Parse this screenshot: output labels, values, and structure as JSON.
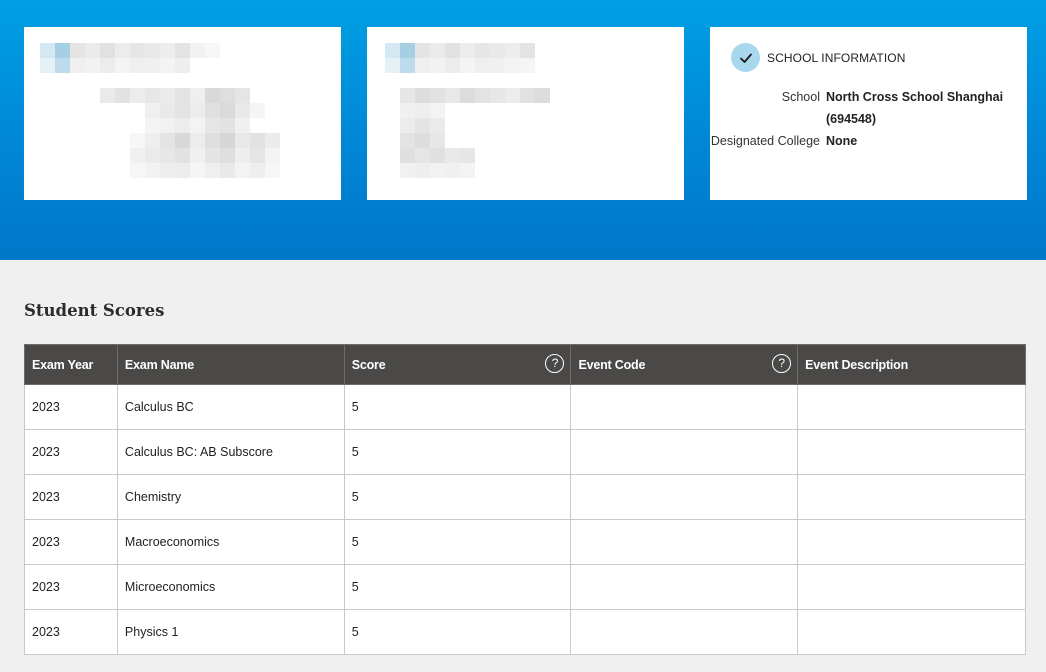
{
  "school_info": {
    "title": "SCHOOL INFORMATION",
    "school_label": "School",
    "school_value": "North Cross School Shanghai (694548)",
    "college_label": "Designated College",
    "college_value": "None"
  },
  "scores": {
    "heading": "Student Scores",
    "columns": [
      "Exam Year",
      "Exam Name",
      "Score",
      "Event Code",
      "Event Description"
    ],
    "help_glyph": "?",
    "rows": [
      {
        "year": "2023",
        "name": "Calculus BC",
        "score": "5",
        "event_code": "",
        "event_description": ""
      },
      {
        "year": "2023",
        "name": "Calculus BC: AB Subscore",
        "score": "5",
        "event_code": "",
        "event_description": ""
      },
      {
        "year": "2023",
        "name": "Chemistry",
        "score": "5",
        "event_code": "",
        "event_description": ""
      },
      {
        "year": "2023",
        "name": "Macroeconomics",
        "score": "5",
        "event_code": "",
        "event_description": ""
      },
      {
        "year": "2023",
        "name": "Microeconomics",
        "score": "5",
        "event_code": "",
        "event_description": ""
      },
      {
        "year": "2023",
        "name": "Physics 1",
        "score": "5",
        "event_code": "",
        "event_description": ""
      }
    ]
  },
  "colors": {
    "hero_top": "#009fe3",
    "hero_bottom": "#0077c8",
    "table_header": "#4a4948",
    "check_badge": "#a9d8ee"
  }
}
